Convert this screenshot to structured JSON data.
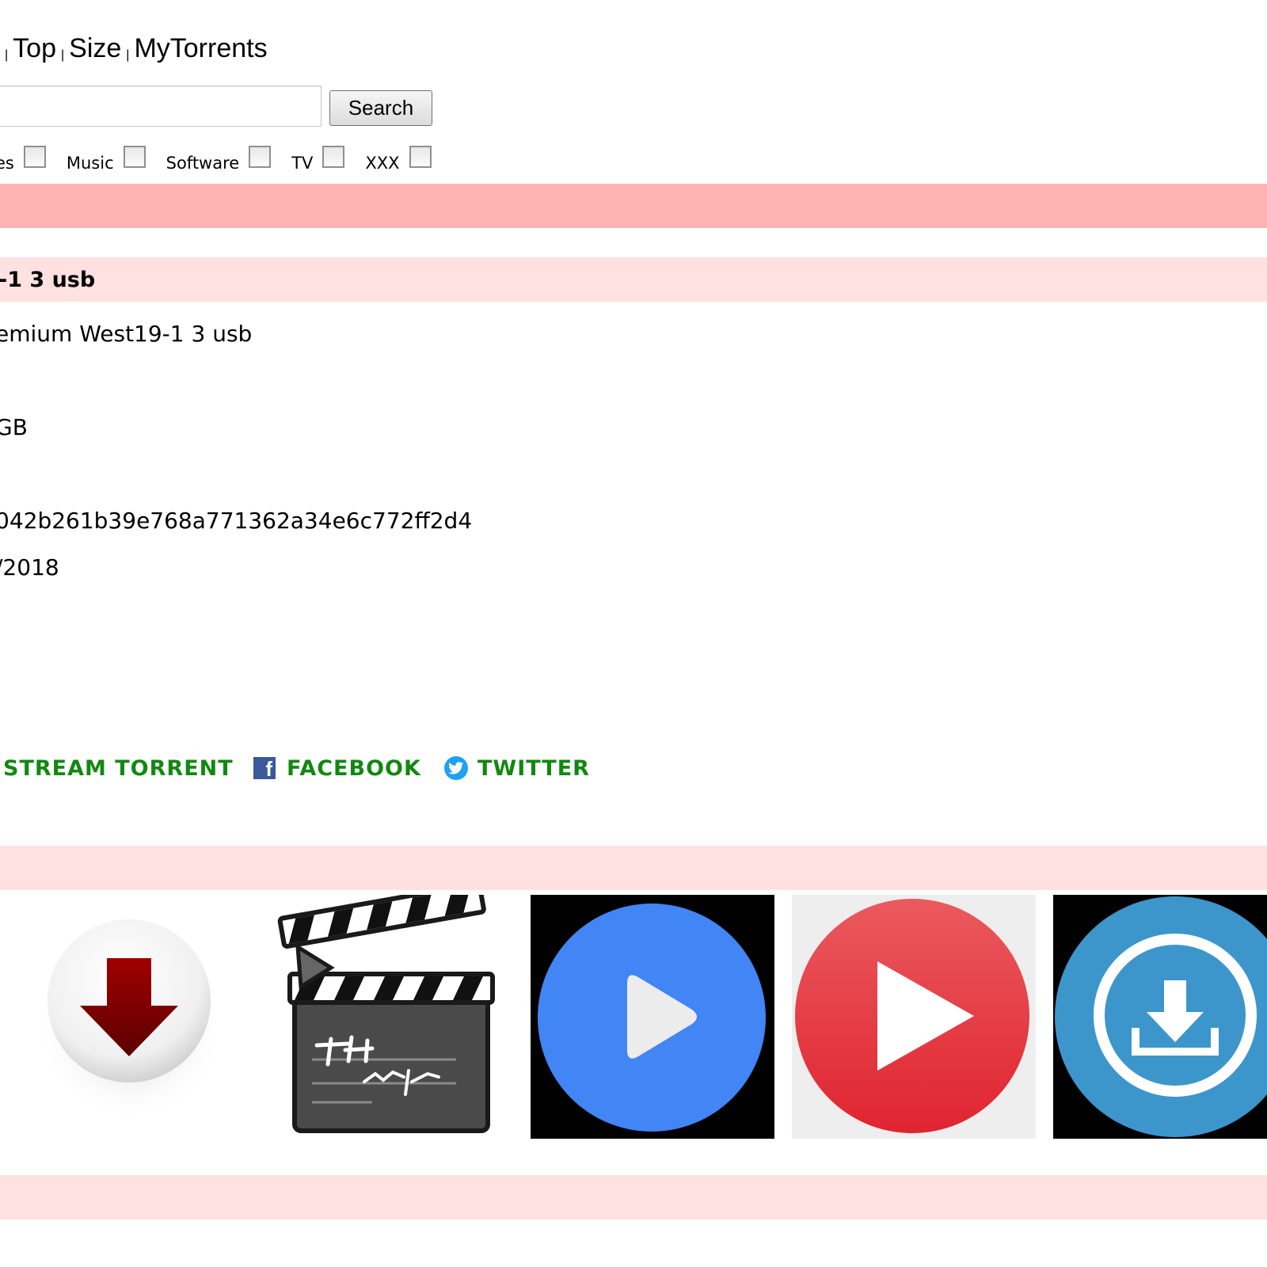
{
  "nav": {
    "partial": "t",
    "separator": "|",
    "items": [
      "Top",
      "Size",
      "MyTorrents"
    ]
  },
  "search": {
    "value": "",
    "button_label": "Search"
  },
  "categories": {
    "partial_label": "es",
    "items": [
      "Music",
      "Software",
      "TV",
      "XXX"
    ]
  },
  "torrent": {
    "title": "-1 3 usb",
    "name": "emium West19-1 3 usb",
    "size": "GB",
    "hash": "042b261b39e768a771362a34e6c772ff2d4",
    "date": "/2018"
  },
  "share": {
    "stream_label": "STREAM TORRENT",
    "facebook_label": "FACEBOOK",
    "twitter_label": "TWITTER"
  },
  "tiles": [
    {
      "icon": "download-arrow-icon"
    },
    {
      "icon": "clapperboard-icon"
    },
    {
      "icon": "blue-play-icon"
    },
    {
      "icon": "red-play-icon"
    },
    {
      "icon": "circle-download-icon"
    }
  ],
  "colors": {
    "band_strong": "#ffb3b3",
    "band_light": "#ffe1e1",
    "share_green": "#118811",
    "facebook_blue": "#3b5998",
    "twitter_blue": "#1da1f2"
  }
}
